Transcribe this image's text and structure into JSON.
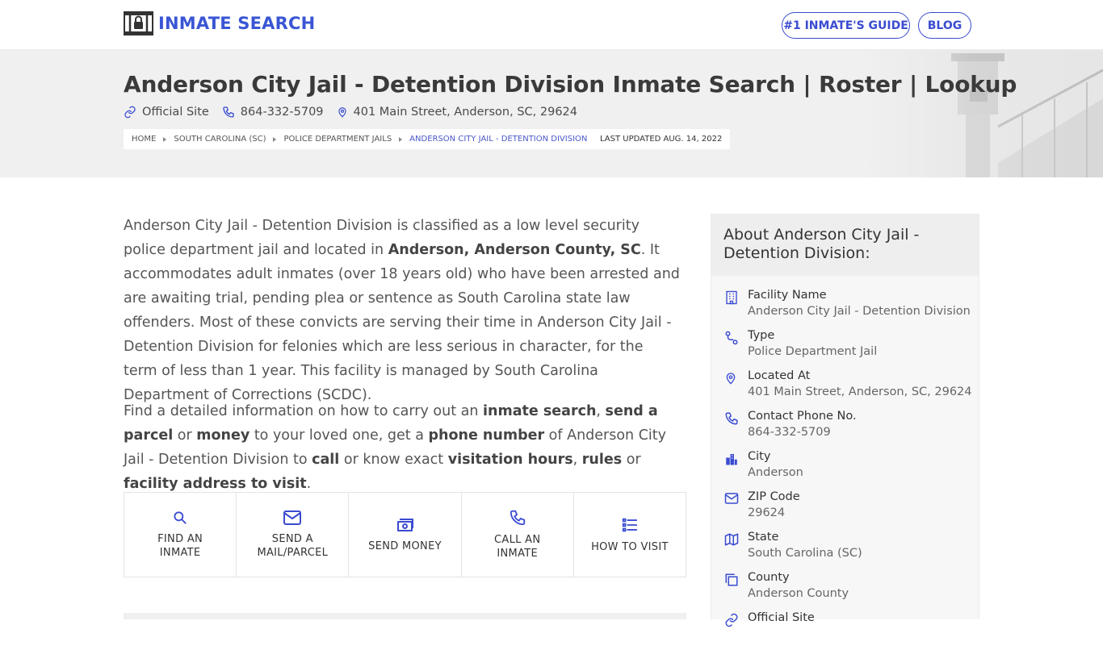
{
  "header": {
    "logo_text": "INMATE SEARCH",
    "nav": [
      "#1 INMATE'S GUIDE",
      "BLOG"
    ]
  },
  "hero": {
    "title": "Anderson City Jail - Detention Division Inmate Search | Roster | Lookup",
    "official_site": "Official Site",
    "phone": "864-332-5709",
    "address": "401 Main Street, Anderson, SC, 29624",
    "breadcrumbs": [
      "HOME",
      "SOUTH CAROLINA (SC)",
      "POLICE DEPARTMENT JAILS",
      "ANDERSON CITY JAIL - DETENTION DIVISION"
    ],
    "updated": "LAST UPDATED AUG. 14, 2022"
  },
  "content": {
    "p1": {
      "a": "Anderson City Jail - Detention Division is classified as a low level security police department jail and located in ",
      "b": "Anderson, Anderson County, SC",
      "c": ". It accommodates adult inmates (over 18 years old) who have been arrested and are awaiting trial, pending plea or sentence as South Carolina state law offenders. Most of these convicts are serving their time in Anderson City Jail - Detention Division for felonies which are less serious in character, for the term of less than 1 year. This facility is managed by South Carolina Department of Corrections (SCDC)."
    },
    "p2": {
      "t1": "Find a detailed information on how to carry out an ",
      "b1": "inmate search",
      "t2": ", ",
      "b2": "send a parcel",
      "t3": " or ",
      "b3": "money",
      "t4": " to your loved one, get a ",
      "b4": "phone number",
      "t5": " of Anderson City Jail - Detention Division to ",
      "b5": "call",
      "t6": " or know exact ",
      "b6": "visitation hours",
      "t7": ", ",
      "b7": "rules",
      "t8": " or ",
      "b8": "facility address to visit",
      "t9": "."
    },
    "actions": [
      {
        "line1": "FIND AN",
        "line2": "INMATE",
        "icon": "search-icon"
      },
      {
        "line1": "SEND A",
        "line2": "MAIL/PARCEL",
        "icon": "mail-icon"
      },
      {
        "line1": "SEND MONEY",
        "line2": "",
        "icon": "money-icon"
      },
      {
        "line1": "CALL AN",
        "line2": "INMATE",
        "icon": "phone-icon"
      },
      {
        "line1": "HOW TO VISIT",
        "line2": "",
        "icon": "list-icon"
      }
    ]
  },
  "sidebar": {
    "title": "About Anderson City Jail - Detention Division:",
    "items": [
      {
        "label": "Facility Name",
        "value": "Anderson City Jail - Detention Division",
        "icon": "building-icon"
      },
      {
        "label": "Type",
        "value": "Police Department Jail",
        "icon": "route-icon"
      },
      {
        "label": "Located At",
        "value": "401 Main Street, Anderson, SC, 29624",
        "icon": "map-pin-icon"
      },
      {
        "label": "Contact Phone No.",
        "value": "864-332-5709",
        "icon": "phone-icon"
      },
      {
        "label": "City",
        "value": "Anderson",
        "icon": "city-icon"
      },
      {
        "label": "ZIP Code",
        "value": "29624",
        "icon": "mail-icon"
      },
      {
        "label": "State",
        "value": "South Carolina (SC)",
        "icon": "map-icon"
      },
      {
        "label": "County",
        "value": "Anderson County",
        "icon": "copy-icon"
      },
      {
        "label": "Official Site",
        "value": "",
        "icon": "link-icon"
      }
    ]
  },
  "colors": {
    "brand_blue": "#3a56d4",
    "text": "#555555",
    "hero_bg": "#f0f0f0"
  }
}
